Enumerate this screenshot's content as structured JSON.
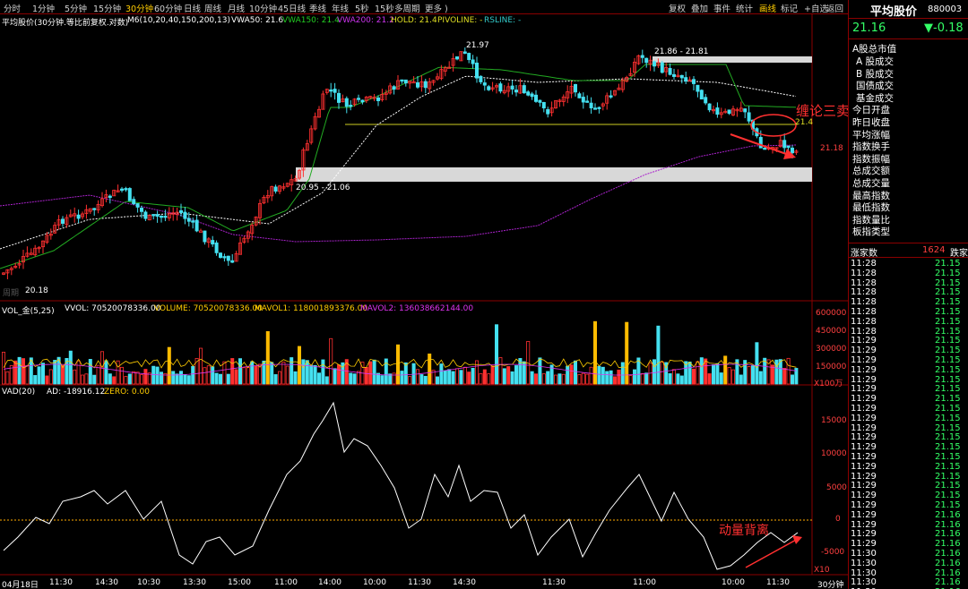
{
  "toolbar": {
    "periods": [
      "分时",
      "1分钟",
      "5分钟",
      "15分钟",
      "30分钟",
      "60分钟",
      "日线",
      "周线",
      "月线",
      "10分钟",
      "45日线",
      "季线",
      "年线",
      "5秒",
      "15秒",
      "多周期",
      "更多 )"
    ],
    "active_period": "30分钟",
    "tools": [
      "复权",
      "叠加",
      "事件",
      "统计",
      "画线",
      "标记",
      "+自选",
      "返回"
    ],
    "active_tool": "画线"
  },
  "price_header": {
    "name": "平均股价(30分钟.等比前复权.对数)",
    "m6": "M6(10,20,40,150,200,13)",
    "vwa50": "VWA50: 21.6",
    "vwa150": "VWA150: 21.4",
    "vwa200": "VWA200: 21.2",
    "hold": "HOLD: 21.4",
    "pivoline": "PIVOLINE: -",
    "rsline": "RSLINE: -"
  },
  "annotations": {
    "high": "21.97",
    "zone_top": "21.86 - 21.81",
    "zone_bottom": "20.95 - 21.06",
    "low": "20.18",
    "support_value": "21.4",
    "last_price_axis": "21.18",
    "chanlun_sell": "缠论三卖",
    "momentum_divergence": "动量背离",
    "watermark": "周期"
  },
  "volume": {
    "header_name": "VOL_金(5,25)",
    "vvol": "VVOL: 70520078336.00",
    "volume": "VOLUME: 70520078336.00",
    "mavol1": "MAVOL1: 118001893376.00",
    "mavol2": "MAVOL2: 136038662144.00",
    "axis": [
      "600000",
      "450000",
      "300000",
      "150000"
    ],
    "unit": "X100万"
  },
  "vad": {
    "header_name": "VAD(20)",
    "ad": "AD: -18916.12",
    "zero": "ZERO: 0.00",
    "axis": [
      "15000",
      "10000",
      "5000",
      "0",
      "-5000"
    ],
    "unit": "X10"
  },
  "time_axis": [
    "04月18日",
    "11:30",
    "14:30",
    "10:30",
    "13:30",
    "15:00",
    "11:00",
    "14:00",
    "10:00",
    "11:30",
    "14:30",
    "11:30",
    "11:00",
    "10:00",
    "11:30"
  ],
  "period_label": "30分钟",
  "right_panel": {
    "title": "平均股价",
    "code": "880003",
    "price": "21.16",
    "change": "▼-0.18",
    "menu_head": "A股总市值",
    "menu_items": [
      "A 股成交",
      "B 股成交",
      "国债成交",
      "基金成交",
      "今日开盘",
      "昨日收盘",
      "平均涨幅",
      "指数换手",
      "指数振幅",
      "总成交额",
      "总成交量",
      "最高指数",
      "最低指数",
      "指数量比",
      "板指类型"
    ],
    "rise_label": "涨家数",
    "rise_value": "1624",
    "fall_label": "跌家",
    "ticks": [
      {
        "time": "11:28",
        "price": "21.15"
      },
      {
        "time": "11:28",
        "price": "21.15"
      },
      {
        "time": "11:28",
        "price": "21.15"
      },
      {
        "time": "11:28",
        "price": "21.15"
      },
      {
        "time": "11:28",
        "price": "21.15"
      },
      {
        "time": "11:28",
        "price": "21.15"
      },
      {
        "time": "11:28",
        "price": "21.15"
      },
      {
        "time": "11:28",
        "price": "21.15"
      },
      {
        "time": "11:29",
        "price": "21.15"
      },
      {
        "time": "11:29",
        "price": "21.15"
      },
      {
        "time": "11:29",
        "price": "21.15"
      },
      {
        "time": "11:29",
        "price": "21.15"
      },
      {
        "time": "11:29",
        "price": "21.15"
      },
      {
        "time": "11:29",
        "price": "21.15"
      },
      {
        "time": "11:29",
        "price": "21.15"
      },
      {
        "time": "11:29",
        "price": "21.15"
      },
      {
        "time": "11:29",
        "price": "21.15"
      },
      {
        "time": "11:29",
        "price": "21.15"
      },
      {
        "time": "11:29",
        "price": "21.15"
      },
      {
        "time": "11:29",
        "price": "21.15"
      },
      {
        "time": "11:29",
        "price": "21.15"
      },
      {
        "time": "11:29",
        "price": "21.15"
      },
      {
        "time": "11:29",
        "price": "21.15"
      },
      {
        "time": "11:29",
        "price": "21.15"
      },
      {
        "time": "11:29",
        "price": "21.15"
      },
      {
        "time": "11:29",
        "price": "21.15"
      },
      {
        "time": "11:29",
        "price": "21.16"
      },
      {
        "time": "11:29",
        "price": "21.16"
      },
      {
        "time": "11:29",
        "price": "21.16"
      },
      {
        "time": "11:29",
        "price": "21.16"
      },
      {
        "time": "11:30",
        "price": "21.16"
      },
      {
        "time": "11:30",
        "price": "21.16"
      },
      {
        "time": "11:30",
        "price": "21.16"
      },
      {
        "time": "11:30",
        "price": "21.16"
      },
      {
        "time": "11:30",
        "price": "21.16"
      }
    ]
  },
  "colors": {
    "up": "#ff3030",
    "down": "#44e0f0",
    "vwa50": "#ffffff",
    "vwa150": "#22aa22",
    "vwa200": "#aa22cc",
    "hold": "#cccc22",
    "accent": "#ffcc00",
    "zone": "#d8d8d8"
  }
}
